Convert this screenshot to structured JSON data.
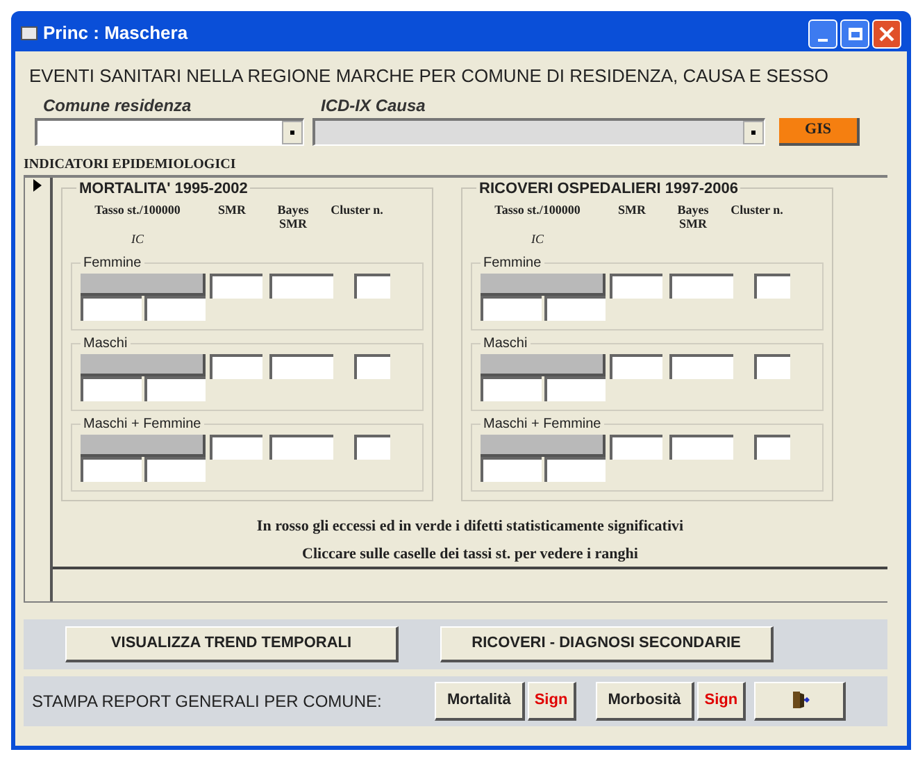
{
  "window": {
    "title": "Princ : Maschera"
  },
  "heading": "EVENTI SANITARI NELLA REGIONE MARCHE PER COMUNE DI RESIDENZA, CAUSA E SESSO",
  "filters": [
    {
      "label": "Comune residenza",
      "disabled": false
    },
    {
      "label": "ICD-IX Causa",
      "disabled": true
    }
  ],
  "gis_button": "GIS",
  "section_title": "INDICATORI EPIDEMIOLOGICI",
  "panels": [
    {
      "title": "MORTALITA' 1995-2002",
      "columns": [
        "Tasso st./100000",
        "SMR",
        "Bayes SMR",
        "Cluster n."
      ],
      "sublabel": "IC",
      "groups": [
        "Femmine",
        "Maschi",
        "Maschi + Femmine"
      ]
    },
    {
      "title": "RICOVERI OSPEDALIERI 1997-2006",
      "columns": [
        "Tasso st./100000",
        "SMR",
        "Bayes SMR",
        "Cluster n."
      ],
      "sublabel": "IC",
      "groups": [
        "Femmine",
        "Maschi",
        "Maschi + Femmine"
      ]
    }
  ],
  "notes": [
    "In rosso gli eccessi ed in verde i difetti statisticamente significativi",
    "Cliccare sulle caselle dei tassi st. per vedere i ranghi"
  ],
  "buttons": [
    "VISUALIZZA TREND TEMPORALI",
    "RICOVERI - DIAGNOSI SECONDARIE"
  ],
  "report": {
    "label": "STAMPA REPORT GENERALI PER COMUNE:",
    "buttons": [
      {
        "kind": "report",
        "label": "Mortalità"
      },
      {
        "kind": "sign",
        "label": "Sign"
      },
      {
        "kind": "report",
        "label": "Morbosità"
      },
      {
        "kind": "sign",
        "label": "Sign"
      },
      {
        "kind": "exit"
      }
    ]
  }
}
